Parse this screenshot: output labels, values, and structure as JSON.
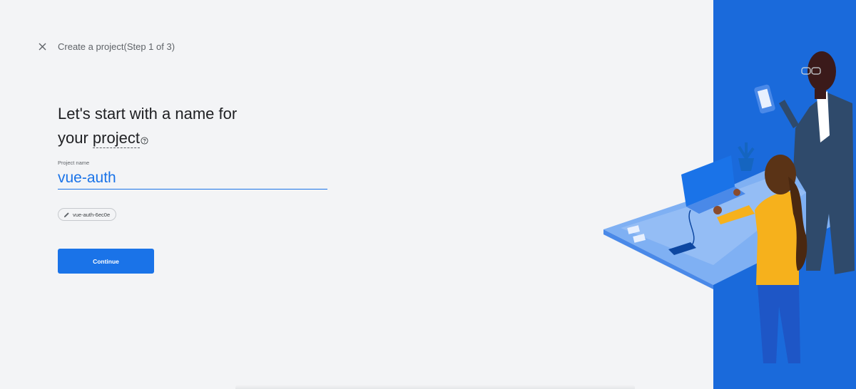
{
  "header": {
    "close_icon": "close-icon",
    "title": "Create a project(Step 1 of 3)"
  },
  "main": {
    "heading_line1": "Let's start with a name for",
    "heading_line2_prefix": "your ",
    "heading_line2_link": "project",
    "help_icon": "help-circle-icon",
    "field": {
      "label": "Project name",
      "value": "vue-auth"
    },
    "project_id_chip": {
      "icon": "pencil-icon",
      "label": "vue-auth-6ec0e"
    },
    "continue_label": "Continue"
  },
  "colors": {
    "accent": "#1a73e8",
    "background": "#f3f4f6",
    "panel": "#1a6adb"
  }
}
